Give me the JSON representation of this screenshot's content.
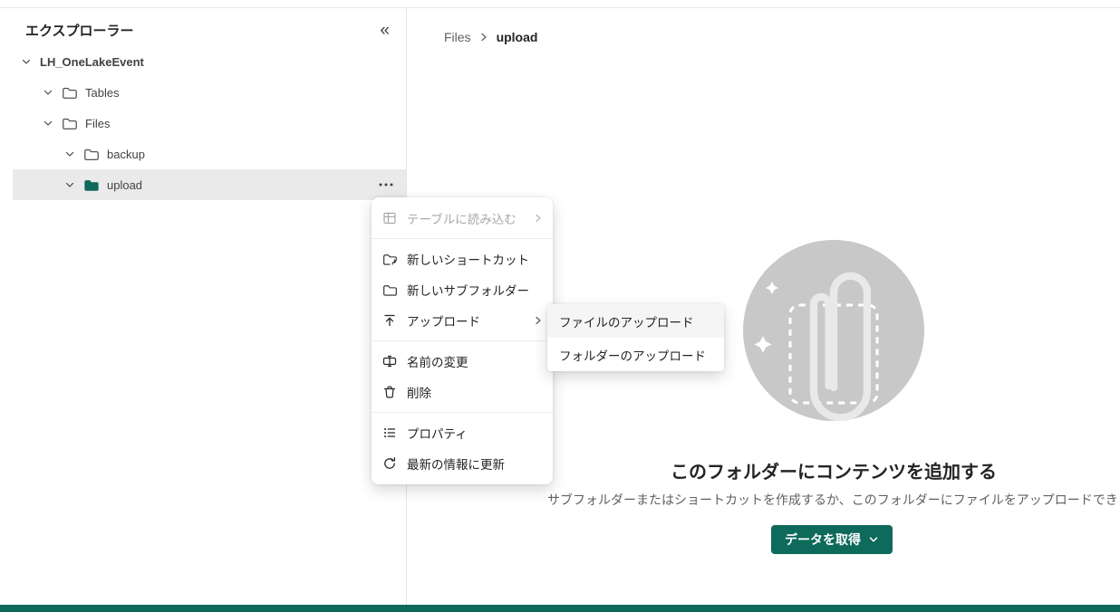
{
  "colors": {
    "accent": "#0e6a5b",
    "selected_row_bg": "#eaeaea",
    "illustration_circle": "#c8c8c8"
  },
  "icons": {
    "collapse": "«"
  },
  "sidebar": {
    "title": "エクスプローラー",
    "root": {
      "label": "LH_OneLakeEvent"
    },
    "items": [
      {
        "label": "Tables"
      },
      {
        "label": "Files"
      },
      {
        "label": "backup"
      },
      {
        "label": "upload"
      }
    ]
  },
  "breadcrumb": {
    "parent": "Files",
    "current": "upload"
  },
  "context_menu": {
    "items": [
      {
        "label": "テーブルに読み込む",
        "disabled": true,
        "has_submenu": true
      },
      {
        "label": "新しいショートカット"
      },
      {
        "label": "新しいサブフォルダー"
      },
      {
        "label": "アップロード",
        "has_submenu": true
      },
      {
        "label": "名前の変更"
      },
      {
        "label": "削除"
      },
      {
        "label": "プロパティ"
      },
      {
        "label": "最新の情報に更新"
      }
    ]
  },
  "submenu": {
    "items": [
      {
        "label": "ファイルのアップロード",
        "highlighted": true
      },
      {
        "label": "フォルダーのアップロード"
      }
    ]
  },
  "empty_state": {
    "title": "このフォルダーにコンテンツを追加する",
    "description": "サブフォルダーまたはショートカットを作成するか、このフォルダーにファイルをアップロードできます。",
    "button_label": "データを取得"
  }
}
